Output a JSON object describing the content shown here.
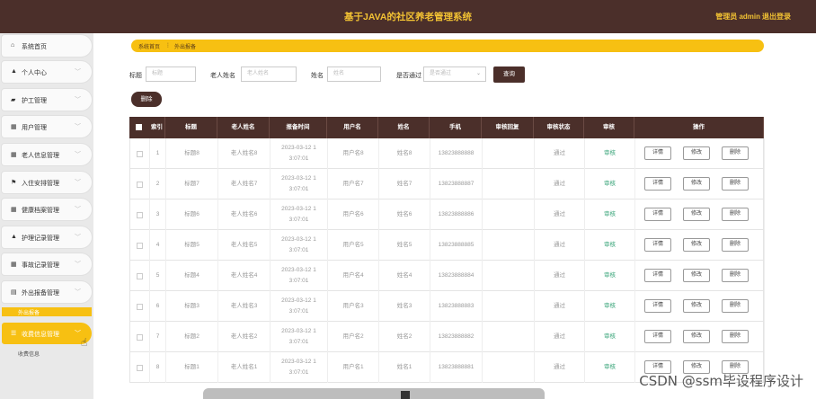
{
  "header": {
    "title": "基于JAVA的社区养老管理系统",
    "admin": "管理员 admin",
    "logout": "退出登录"
  },
  "sidebar": {
    "items": [
      {
        "icon": "home-icon",
        "glyph": "⌂",
        "label": "系统首页",
        "chevron": ""
      },
      {
        "icon": "user-icon",
        "glyph": "▲",
        "label": "个人中心",
        "chevron": "﹀"
      },
      {
        "icon": "bank-icon",
        "glyph": "▰",
        "label": "护工管理",
        "chevron": "﹀"
      },
      {
        "icon": "grid-icon",
        "glyph": "▦",
        "label": "用户管理",
        "chevron": "﹀"
      },
      {
        "icon": "grid-icon",
        "glyph": "▦",
        "label": "老人信息管理",
        "chevron": "﹀"
      },
      {
        "icon": "flag-icon",
        "glyph": "⚑",
        "label": "入住安排管理",
        "chevron": "﹀"
      },
      {
        "icon": "table-icon",
        "glyph": "▦",
        "label": "健康档案管理",
        "chevron": "﹀"
      },
      {
        "icon": "user-icon",
        "glyph": "▲",
        "label": "护理记录管理",
        "chevron": "﹀"
      },
      {
        "icon": "grid-icon",
        "glyph": "▦",
        "label": "事故记录管理",
        "chevron": "﹀"
      },
      {
        "icon": "doc-icon",
        "glyph": "▤",
        "label": "外出报备管理",
        "chevron": "﹀"
      },
      {
        "icon": "list-icon",
        "glyph": "☰",
        "label": "收费信息管理",
        "chevron": "﹀"
      }
    ],
    "sub_active": "外出报备",
    "sub_below": "收费信息"
  },
  "breadcrumb": {
    "home": "系统首页",
    "sep": "⋮",
    "current": "外出报备"
  },
  "search": {
    "title_label": "标题",
    "title_placeholder": "标题",
    "elder_label": "老人姓名",
    "elder_placeholder": "老人姓名",
    "name_label": "姓名",
    "name_placeholder": "姓名",
    "pass_label": "是否通过",
    "pass_placeholder": "是否通过",
    "query_button": "查询"
  },
  "delete_button": "删除",
  "table": {
    "headers": [
      "索引",
      "标题",
      "老人姓名",
      "报备时间",
      "用户名",
      "姓名",
      "手机",
      "审核回复",
      "审核状态",
      "审核",
      "操作"
    ],
    "op_labels": {
      "detail": "详情",
      "edit": "修改",
      "delete": "删除"
    },
    "rows": [
      {
        "idx": "1",
        "title": "标题8",
        "elder": "老人姓名8",
        "time1": "2023-03-12 1",
        "time2": "3:07:01",
        "user": "用户名8",
        "name": "姓名8",
        "phone": "13823888888",
        "reply": "",
        "status": "通过",
        "audit": "审核"
      },
      {
        "idx": "2",
        "title": "标题7",
        "elder": "老人姓名7",
        "time1": "2023-03-12 1",
        "time2": "3:07:01",
        "user": "用户名7",
        "name": "姓名7",
        "phone": "13823888887",
        "reply": "",
        "status": "通过",
        "audit": "审核"
      },
      {
        "idx": "3",
        "title": "标题6",
        "elder": "老人姓名6",
        "time1": "2023-03-12 1",
        "time2": "3:07:01",
        "user": "用户名6",
        "name": "姓名6",
        "phone": "13823888886",
        "reply": "",
        "status": "通过",
        "audit": "审核"
      },
      {
        "idx": "4",
        "title": "标题5",
        "elder": "老人姓名5",
        "time1": "2023-03-12 1",
        "time2": "3:07:01",
        "user": "用户名5",
        "name": "姓名5",
        "phone": "13823888885",
        "reply": "",
        "status": "通过",
        "audit": "审核"
      },
      {
        "idx": "5",
        "title": "标题4",
        "elder": "老人姓名4",
        "time1": "2023-03-12 1",
        "time2": "3:07:01",
        "user": "用户名4",
        "name": "姓名4",
        "phone": "13823888884",
        "reply": "",
        "status": "通过",
        "audit": "审核"
      },
      {
        "idx": "6",
        "title": "标题3",
        "elder": "老人姓名3",
        "time1": "2023-03-12 1",
        "time2": "3:07:01",
        "user": "用户名3",
        "name": "姓名3",
        "phone": "13823888883",
        "reply": "",
        "status": "通过",
        "audit": "审核"
      },
      {
        "idx": "7",
        "title": "标题2",
        "elder": "老人姓名2",
        "time1": "2023-03-12 1",
        "time2": "3:07:01",
        "user": "用户名2",
        "name": "姓名2",
        "phone": "13823888882",
        "reply": "",
        "status": "通过",
        "audit": "审核"
      },
      {
        "idx": "8",
        "title": "标题1",
        "elder": "老人姓名1",
        "time1": "2023-03-12 1",
        "time2": "3:07:01",
        "user": "用户名1",
        "name": "姓名1",
        "phone": "13823888881",
        "reply": "",
        "status": "通过",
        "audit": "审核"
      }
    ]
  },
  "watermark": "CSDN @ssm毕设程序设计",
  "colors": {
    "brand_dark": "#4b2f2a",
    "accent": "#f7c012",
    "title_gold": "#f2c233",
    "audit_green": "#3aa57a"
  }
}
